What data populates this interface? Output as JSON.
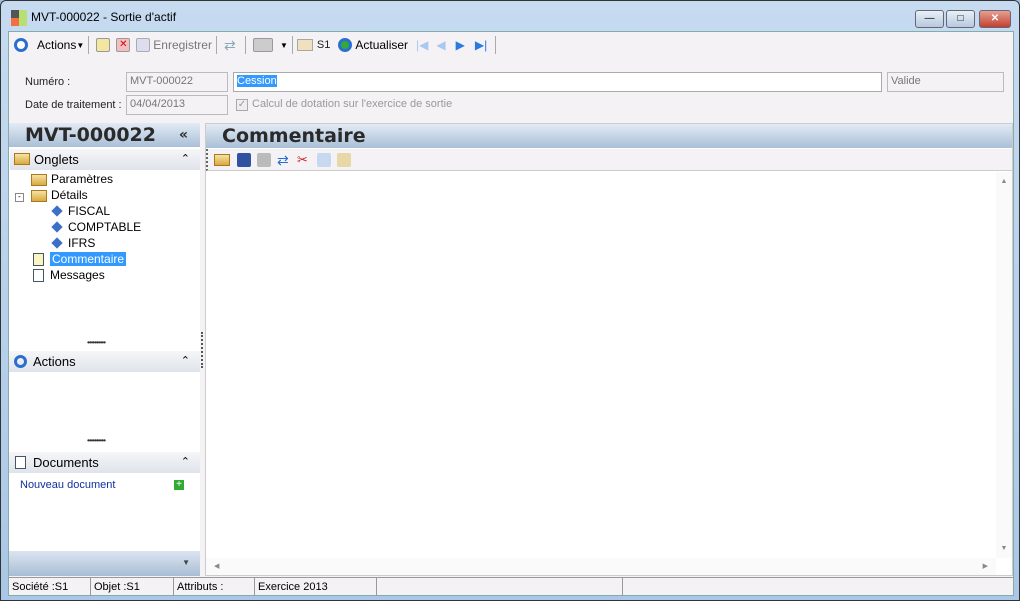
{
  "window": {
    "title": "MVT-000022 -  Sortie d'actif",
    "min": "—",
    "max": "□",
    "close": "✕"
  },
  "toolbar": {
    "actions": "Actions",
    "save": "Enregistrer",
    "s1": "S1",
    "refresh": "Actualiser"
  },
  "form": {
    "numero_label": "Numéro :",
    "numero": "MVT-000022",
    "libelle": "Cession",
    "statut": "Valide",
    "date_label": "Date de traitement :",
    "date": "04/04/2013",
    "checkbox_label": "Calcul de dotation sur l'exercice de sortie",
    "checkbox_checked": true
  },
  "left": {
    "title": "MVT-000022",
    "collapse": "«",
    "onglets": "Onglets",
    "tree": [
      "Paramètres",
      "Détails",
      "FISCAL",
      "COMPTABLE",
      "IFRS",
      "Commentaire",
      "Messages"
    ],
    "actions": "Actions",
    "documents": "Documents",
    "new_document": "Nouveau document"
  },
  "right": {
    "title": "Commentaire"
  },
  "status": {
    "societe": "Société :S1",
    "objet": "Objet :S1",
    "attributs": "Attributs :",
    "exercice": "Exercice 2013"
  }
}
